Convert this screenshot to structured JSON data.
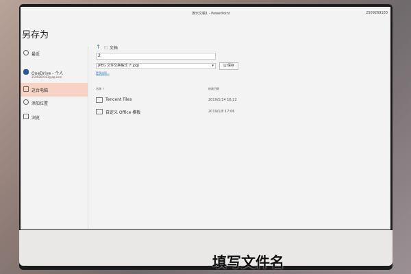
{
  "window": {
    "title": "演示文稿1 - PowerPoint",
    "account": "2509269183"
  },
  "page_title": "另存为",
  "sidebar": {
    "items": [
      {
        "label": "最近",
        "icon": "clock-icon"
      },
      {
        "label": "OneDrive - 个人",
        "sub": "2509269183@qq.com",
        "icon": "cloud-icon"
      },
      {
        "label": "这台电脑",
        "icon": "computer-icon",
        "active": true
      },
      {
        "label": "添加位置",
        "icon": "globe-icon"
      },
      {
        "label": "浏览",
        "icon": "folder-icon"
      }
    ]
  },
  "main": {
    "breadcrumb": "文档",
    "filename_value": "2",
    "filetype_value": "JPEG 文件交换格式 (*.jpg)",
    "save_label": "保存",
    "more_options": "更多选项...",
    "columns": {
      "name": "名称 ↑",
      "modified": "修改日期"
    },
    "files": [
      {
        "name": "Tencent Files",
        "date": "2019/1/14 16:22"
      },
      {
        "name": "自定义 Office 模板",
        "date": "2019/1/8 17:06"
      }
    ]
  },
  "caption": "填写文件名"
}
